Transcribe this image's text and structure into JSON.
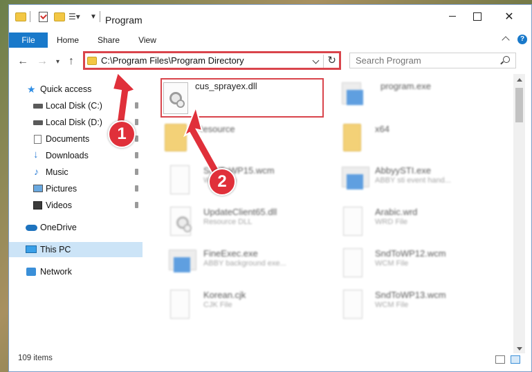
{
  "window": {
    "title": "Program",
    "controls": {
      "minimize": "minimize",
      "maximize": "maximize",
      "close": "✕"
    }
  },
  "ribbon": {
    "tabs": [
      "File",
      "Home",
      "Share",
      "View"
    ],
    "help": "?"
  },
  "address": {
    "path": "C:\\Program Files\\Program Directory"
  },
  "search": {
    "placeholder": "Search Program"
  },
  "sidebar": {
    "items": [
      {
        "label": "Quick access",
        "icon": "star-icon"
      },
      {
        "label": "Local Disk (C:)",
        "icon": "drive-icon"
      },
      {
        "label": "Local Disk (D:)",
        "icon": "drive-icon"
      },
      {
        "label": "Documents",
        "icon": "documents-icon"
      },
      {
        "label": "Downloads",
        "icon": "download-icon"
      },
      {
        "label": "Music",
        "icon": "music-icon"
      },
      {
        "label": "Pictures",
        "icon": "pictures-icon"
      },
      {
        "label": "Videos",
        "icon": "videos-icon"
      },
      {
        "label": "OneDrive",
        "icon": "cloud-icon"
      },
      {
        "label": "This PC",
        "icon": "computer-icon"
      },
      {
        "label": "Network",
        "icon": "network-icon"
      }
    ],
    "active": "This PC"
  },
  "files": [
    {
      "name": "cus_sprayex.dll",
      "type": "",
      "icon": "dll-file-icon"
    },
    {
      "name": "program.exe",
      "type": "",
      "icon": "exe-file-icon"
    },
    {
      "name": "Resource",
      "type": "",
      "icon": "folder-icon"
    },
    {
      "name": "x64",
      "type": "",
      "icon": "folder-icon"
    },
    {
      "name": "SndToWP15.wcm",
      "type": "WCM File",
      "icon": "document-icon"
    },
    {
      "name": "AbbyySTI.exe",
      "type": "ABBY sti event hand...",
      "icon": "exe-file-icon"
    },
    {
      "name": "UpdateClient65.dll",
      "type": "Resource DLL",
      "icon": "dll-file-icon"
    },
    {
      "name": "Arabic.wrd",
      "type": "WRD File",
      "icon": "document-icon"
    },
    {
      "name": "FineExec.exe",
      "type": "ABBY background exe...",
      "icon": "exe-file-icon"
    },
    {
      "name": "SndToWP12.wcm",
      "type": "WCM File",
      "icon": "document-icon"
    },
    {
      "name": "Korean.cjk",
      "type": "CJK File",
      "icon": "document-icon"
    },
    {
      "name": "SndToWP13.wcm",
      "type": "WCM File",
      "icon": "document-icon"
    }
  ],
  "status": {
    "item_count": "109 items"
  },
  "annotations": {
    "step1": "1",
    "step2": "2",
    "color": "#e0303a"
  }
}
